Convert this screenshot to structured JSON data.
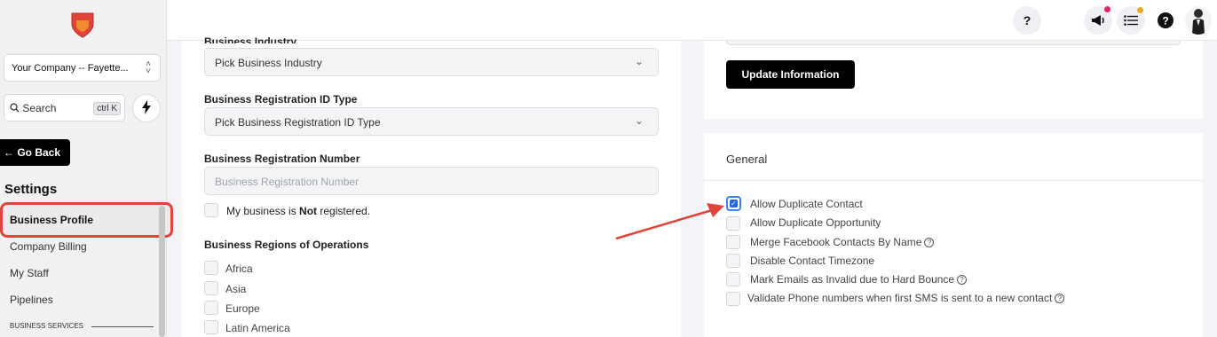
{
  "sidebar": {
    "company_select": "Your Company -- Fayette...",
    "search_label": "Search",
    "search_shortcut": "ctrl K",
    "go_back": "← Go Back",
    "settings_title": "Settings",
    "nav_items": [
      {
        "label": "Business Profile"
      },
      {
        "label": "Company Billing"
      },
      {
        "label": "My Staff"
      },
      {
        "label": "Pipelines"
      }
    ],
    "section_label": "BUSINESS SERVICES"
  },
  "header": {
    "help_label": "?",
    "notification_dot_color": "#e0245e",
    "list_dot_color": "#f5a623"
  },
  "form": {
    "business_industry_label": "Business Industry",
    "business_industry_value": "Pick Business Industry",
    "registration_type_label": "Business Registration ID Type",
    "registration_type_value": "Pick Business Registration ID Type",
    "registration_number_label": "Business Registration Number",
    "registration_number_placeholder": "Business Registration Number",
    "not_registered_prefix": "My business is ",
    "not_registered_bold": "Not",
    "not_registered_suffix": " registered.",
    "regions_label": "Business Regions of Operations",
    "regions": [
      "Africa",
      "Asia",
      "Europe",
      "Latin America"
    ]
  },
  "update": {
    "button_label": "Update Information"
  },
  "general": {
    "title": "General",
    "options": [
      {
        "label": "Allow Duplicate Contact",
        "checked": true,
        "help": false
      },
      {
        "label": "Allow Duplicate Opportunity",
        "checked": false,
        "help": false
      },
      {
        "label": "Merge Facebook Contacts By Name",
        "checked": false,
        "help": true
      },
      {
        "label": "Disable Contact Timezone",
        "checked": false,
        "help": false
      },
      {
        "label": "Mark Emails as Invalid due to Hard Bounce",
        "checked": false,
        "help": true
      },
      {
        "label": "Validate Phone numbers when first SMS is sent to a new contact",
        "checked": false,
        "help": true
      }
    ]
  },
  "colors": {
    "highlight": "#e0443a",
    "checkbox_checked": "#2563eb",
    "primary_button": "#000000"
  }
}
